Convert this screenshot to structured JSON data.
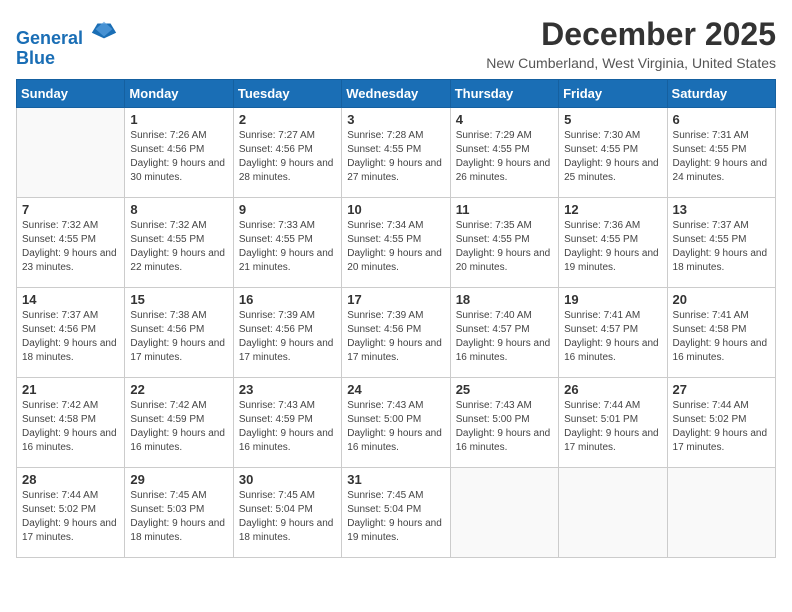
{
  "header": {
    "logo_line1": "General",
    "logo_line2": "Blue",
    "month": "December 2025",
    "location": "New Cumberland, West Virginia, United States"
  },
  "weekdays": [
    "Sunday",
    "Monday",
    "Tuesday",
    "Wednesday",
    "Thursday",
    "Friday",
    "Saturday"
  ],
  "weeks": [
    [
      {
        "day": "",
        "sunrise": "",
        "sunset": "",
        "daylight": ""
      },
      {
        "day": "1",
        "sunrise": "Sunrise: 7:26 AM",
        "sunset": "Sunset: 4:56 PM",
        "daylight": "Daylight: 9 hours and 30 minutes."
      },
      {
        "day": "2",
        "sunrise": "Sunrise: 7:27 AM",
        "sunset": "Sunset: 4:56 PM",
        "daylight": "Daylight: 9 hours and 28 minutes."
      },
      {
        "day": "3",
        "sunrise": "Sunrise: 7:28 AM",
        "sunset": "Sunset: 4:55 PM",
        "daylight": "Daylight: 9 hours and 27 minutes."
      },
      {
        "day": "4",
        "sunrise": "Sunrise: 7:29 AM",
        "sunset": "Sunset: 4:55 PM",
        "daylight": "Daylight: 9 hours and 26 minutes."
      },
      {
        "day": "5",
        "sunrise": "Sunrise: 7:30 AM",
        "sunset": "Sunset: 4:55 PM",
        "daylight": "Daylight: 9 hours and 25 minutes."
      },
      {
        "day": "6",
        "sunrise": "Sunrise: 7:31 AM",
        "sunset": "Sunset: 4:55 PM",
        "daylight": "Daylight: 9 hours and 24 minutes."
      }
    ],
    [
      {
        "day": "7",
        "sunrise": "Sunrise: 7:32 AM",
        "sunset": "Sunset: 4:55 PM",
        "daylight": "Daylight: 9 hours and 23 minutes."
      },
      {
        "day": "8",
        "sunrise": "Sunrise: 7:32 AM",
        "sunset": "Sunset: 4:55 PM",
        "daylight": "Daylight: 9 hours and 22 minutes."
      },
      {
        "day": "9",
        "sunrise": "Sunrise: 7:33 AM",
        "sunset": "Sunset: 4:55 PM",
        "daylight": "Daylight: 9 hours and 21 minutes."
      },
      {
        "day": "10",
        "sunrise": "Sunrise: 7:34 AM",
        "sunset": "Sunset: 4:55 PM",
        "daylight": "Daylight: 9 hours and 20 minutes."
      },
      {
        "day": "11",
        "sunrise": "Sunrise: 7:35 AM",
        "sunset": "Sunset: 4:55 PM",
        "daylight": "Daylight: 9 hours and 20 minutes."
      },
      {
        "day": "12",
        "sunrise": "Sunrise: 7:36 AM",
        "sunset": "Sunset: 4:55 PM",
        "daylight": "Daylight: 9 hours and 19 minutes."
      },
      {
        "day": "13",
        "sunrise": "Sunrise: 7:37 AM",
        "sunset": "Sunset: 4:55 PM",
        "daylight": "Daylight: 9 hours and 18 minutes."
      }
    ],
    [
      {
        "day": "14",
        "sunrise": "Sunrise: 7:37 AM",
        "sunset": "Sunset: 4:56 PM",
        "daylight": "Daylight: 9 hours and 18 minutes."
      },
      {
        "day": "15",
        "sunrise": "Sunrise: 7:38 AM",
        "sunset": "Sunset: 4:56 PM",
        "daylight": "Daylight: 9 hours and 17 minutes."
      },
      {
        "day": "16",
        "sunrise": "Sunrise: 7:39 AM",
        "sunset": "Sunset: 4:56 PM",
        "daylight": "Daylight: 9 hours and 17 minutes."
      },
      {
        "day": "17",
        "sunrise": "Sunrise: 7:39 AM",
        "sunset": "Sunset: 4:56 PM",
        "daylight": "Daylight: 9 hours and 17 minutes."
      },
      {
        "day": "18",
        "sunrise": "Sunrise: 7:40 AM",
        "sunset": "Sunset: 4:57 PM",
        "daylight": "Daylight: 9 hours and 16 minutes."
      },
      {
        "day": "19",
        "sunrise": "Sunrise: 7:41 AM",
        "sunset": "Sunset: 4:57 PM",
        "daylight": "Daylight: 9 hours and 16 minutes."
      },
      {
        "day": "20",
        "sunrise": "Sunrise: 7:41 AM",
        "sunset": "Sunset: 4:58 PM",
        "daylight": "Daylight: 9 hours and 16 minutes."
      }
    ],
    [
      {
        "day": "21",
        "sunrise": "Sunrise: 7:42 AM",
        "sunset": "Sunset: 4:58 PM",
        "daylight": "Daylight: 9 hours and 16 minutes."
      },
      {
        "day": "22",
        "sunrise": "Sunrise: 7:42 AM",
        "sunset": "Sunset: 4:59 PM",
        "daylight": "Daylight: 9 hours and 16 minutes."
      },
      {
        "day": "23",
        "sunrise": "Sunrise: 7:43 AM",
        "sunset": "Sunset: 4:59 PM",
        "daylight": "Daylight: 9 hours and 16 minutes."
      },
      {
        "day": "24",
        "sunrise": "Sunrise: 7:43 AM",
        "sunset": "Sunset: 5:00 PM",
        "daylight": "Daylight: 9 hours and 16 minutes."
      },
      {
        "day": "25",
        "sunrise": "Sunrise: 7:43 AM",
        "sunset": "Sunset: 5:00 PM",
        "daylight": "Daylight: 9 hours and 16 minutes."
      },
      {
        "day": "26",
        "sunrise": "Sunrise: 7:44 AM",
        "sunset": "Sunset: 5:01 PM",
        "daylight": "Daylight: 9 hours and 17 minutes."
      },
      {
        "day": "27",
        "sunrise": "Sunrise: 7:44 AM",
        "sunset": "Sunset: 5:02 PM",
        "daylight": "Daylight: 9 hours and 17 minutes."
      }
    ],
    [
      {
        "day": "28",
        "sunrise": "Sunrise: 7:44 AM",
        "sunset": "Sunset: 5:02 PM",
        "daylight": "Daylight: 9 hours and 17 minutes."
      },
      {
        "day": "29",
        "sunrise": "Sunrise: 7:45 AM",
        "sunset": "Sunset: 5:03 PM",
        "daylight": "Daylight: 9 hours and 18 minutes."
      },
      {
        "day": "30",
        "sunrise": "Sunrise: 7:45 AM",
        "sunset": "Sunset: 5:04 PM",
        "daylight": "Daylight: 9 hours and 18 minutes."
      },
      {
        "day": "31",
        "sunrise": "Sunrise: 7:45 AM",
        "sunset": "Sunset: 5:04 PM",
        "daylight": "Daylight: 9 hours and 19 minutes."
      },
      {
        "day": "",
        "sunrise": "",
        "sunset": "",
        "daylight": ""
      },
      {
        "day": "",
        "sunrise": "",
        "sunset": "",
        "daylight": ""
      },
      {
        "day": "",
        "sunrise": "",
        "sunset": "",
        "daylight": ""
      }
    ]
  ]
}
